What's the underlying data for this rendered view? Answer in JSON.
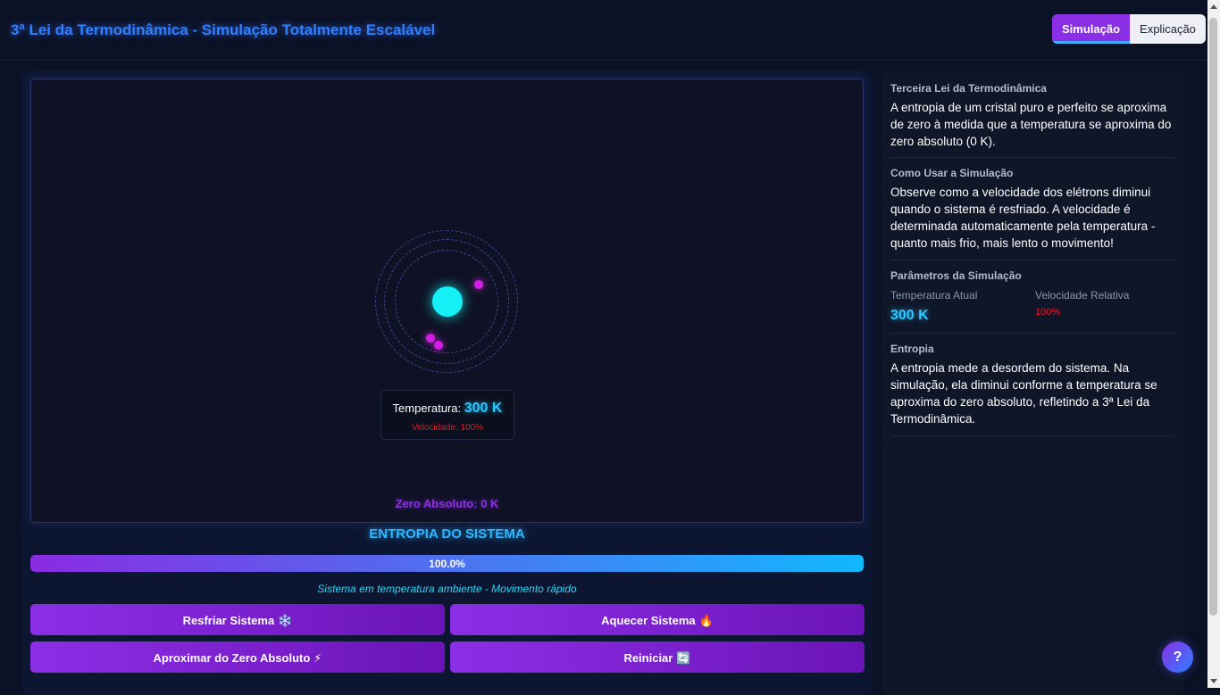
{
  "header": {
    "title": "3ª Lei da Termodinâmica - Simulação Totalmente Escalável",
    "tabs": [
      {
        "label": "Simulação",
        "active": true
      },
      {
        "label": "Explicação",
        "active": false
      }
    ]
  },
  "simulation": {
    "temperature_label": "Temperatura:",
    "temperature_value": "300 K",
    "speed_text": "Velocidade: 100%",
    "zero_label": "Zero Absoluto: 0 K"
  },
  "entropy": {
    "title": "ENTROPIA DO SISTEMA",
    "value_text": "100.0%",
    "value": 100.0,
    "status": "Sistema em temperatura ambiente - Movimento rápido"
  },
  "buttons": {
    "cool": {
      "label": "Resfriar Sistema",
      "emoji": "❄️"
    },
    "heat": {
      "label": "Aquecer Sistema",
      "emoji": "🔥"
    },
    "zero": {
      "label": "Aproximar do Zero Absoluto",
      "emoji": "⚡"
    },
    "reset": {
      "label": "Reiniciar",
      "emoji": "🔄"
    }
  },
  "info": {
    "law_title": "Terceira Lei da Termodinâmica",
    "law_text": "A entropia de um cristal puro e perfeito se aproxima de zero à medida que a temperatura se aproxima do zero absoluto (0 K).",
    "usage_title": "Como Usar a Simulação",
    "usage_text": "Observe como a velocidade dos elétrons diminui quando o sistema é resfriado. A velocidade é determinada automaticamente pela temperatura - quanto mais frio, mais lento o movimento!",
    "params_title": "Parâmetros da Simulação",
    "temp_label": "Temperatura Atual",
    "temp_value": "300 K",
    "speed_label": "Velocidade Relativa",
    "speed_value": "100%",
    "entropy_title": "Entropia",
    "entropy_text": "A entropia mede a desordem do sistema. Na simulação, ela diminui conforme a temperatura se aproxima do zero absoluto, refletindo a 3ª Lei da Termodinâmica."
  },
  "help": {
    "label": "?"
  },
  "colors": {
    "accent_purple": "#8b2fe6",
    "accent_cyan": "#2ac8ff",
    "nucleus": "#14f0f5",
    "electron": "#d21ee6",
    "warning_red": "#e6192b"
  }
}
